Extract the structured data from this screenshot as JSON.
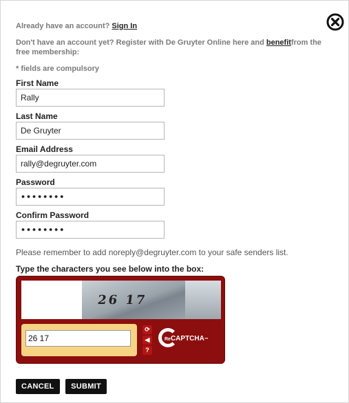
{
  "header": {
    "signin_prompt": "Already have an account?",
    "signin_link": "Sign In",
    "intro_text": "Don't have an account yet? Register with De Gruyter Online here and ",
    "benefit_link": "benefit",
    "intro_text_end": "from the free membership:",
    "required_note": "* fields are compulsory"
  },
  "form": {
    "first_name": {
      "label": "First Name",
      "value": "Rally"
    },
    "last_name": {
      "label": "Last Name",
      "value": "De Gruyter"
    },
    "email": {
      "label": "Email Address",
      "value": "rally@degruyter.com"
    },
    "password": {
      "label": "Password",
      "value": "••••••••"
    },
    "confirm_password": {
      "label": "Confirm Password",
      "value": "••••••••"
    }
  },
  "safe_senders_note": "Please remember to add noreply@degruyter.com to your safe senders list.",
  "captcha": {
    "label": "Type the characters you see below into the box:",
    "image_text": "26 17",
    "input_value": "26 17",
    "brand": "reCAPTCHA",
    "brand_prefix": "Re",
    "brand_main": "CAPTCHA",
    "trademark": "™",
    "colors": {
      "frame": "#8d0e0e",
      "input_bg": "#f7d484"
    }
  },
  "actions": {
    "cancel_label": "CANCEL",
    "submit_label": "SUBMIT"
  }
}
